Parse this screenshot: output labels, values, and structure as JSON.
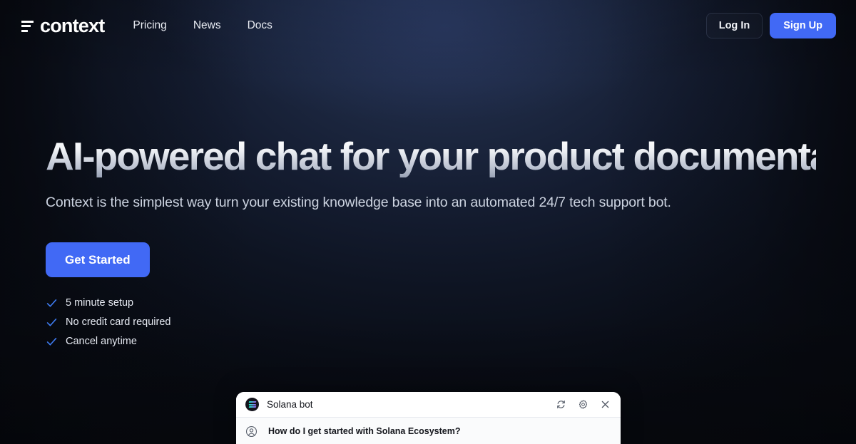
{
  "brand": {
    "name": "context",
    "mark": "three-bars-logo"
  },
  "nav": {
    "links": [
      {
        "label": "Pricing"
      },
      {
        "label": "News"
      },
      {
        "label": "Docs"
      }
    ],
    "login_label": "Log In",
    "signup_label": "Sign Up"
  },
  "hero": {
    "headline": "AI-powered chat for your product documentation.",
    "subhead": "Context is the simplest way turn your existing knowledge base into an automated 24/7 tech support bot.",
    "cta_label": "Get Started",
    "features": [
      {
        "label": "5 minute setup"
      },
      {
        "label": "No credit card required"
      },
      {
        "label": "Cancel anytime"
      }
    ]
  },
  "chat_widget": {
    "title": "Solana bot",
    "avatar": "solana-logo",
    "actions": [
      {
        "name": "refresh"
      },
      {
        "name": "settings"
      },
      {
        "name": "close"
      }
    ],
    "messages": [
      {
        "author": "user",
        "text": "How do I get started with Solana Ecosystem?"
      }
    ]
  },
  "colors": {
    "accent_blue": "#4169f5",
    "check_blue": "#3e7bf0",
    "background_dark": "#0a0e18",
    "background_glow": "#263355",
    "widget_white": "#ffffff"
  }
}
